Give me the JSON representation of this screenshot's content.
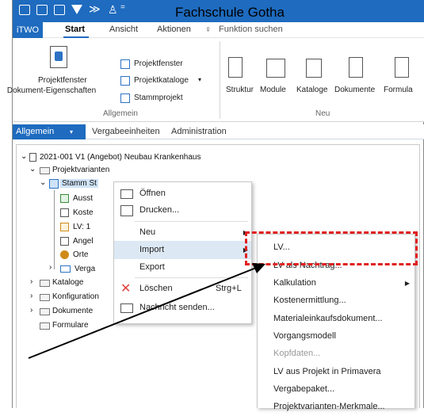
{
  "window": {
    "title": "Fachschule Gotha"
  },
  "ribbon_tabs": [
    "iTWO",
    "Start",
    "Ansicht",
    "Aktionen"
  ],
  "search": {
    "placeholder": "Funktion suchen"
  },
  "ribbon": {
    "big_button_label_1": "Projektfenster",
    "big_button_label_2": "Dokument-Eigenschaften",
    "small_buttons": [
      "Projektfenster",
      "Projektkataloge",
      "Stammprojekt"
    ],
    "group_allgemein": "Allgemein",
    "neu_buttons": [
      "Struktur",
      "Module",
      "Kataloge",
      "Dokumente",
      "Formula"
    ],
    "group_neu": "Neu"
  },
  "nav2": [
    "Allgemein",
    "Vergabeeinheiten",
    "Administration"
  ],
  "tree": {
    "root": "2021-001 V1 (Angebot) Neubau Krankenhaus",
    "projektvarianten": "Projektvarianten",
    "stamm": "Stamm St",
    "children": [
      "Ausst",
      "Koste",
      "LV: 1",
      "Angel",
      "Orte",
      "Verga"
    ],
    "others": [
      "Kataloge",
      "Konfiguration",
      "Dokumente",
      "Formulare"
    ]
  },
  "context_menu": {
    "items": [
      "Öffnen",
      "Drucken...",
      "Neu",
      "Import",
      "Export",
      "Löschen",
      "Nachricht senden..."
    ],
    "shortcut_loeschen": "Strg+L"
  },
  "submenu": {
    "items": [
      "LV...",
      "LV als Nachtrag...",
      "Kalkulation",
      "Kostenermittlung...",
      "Materialeinkaufsdokument...",
      "Vorgangsmodell",
      "Kopfdaten...",
      "LV aus Projekt in Primavera",
      "Vergabepaket...",
      "Projektvarianten-Merkmale..."
    ]
  },
  "colors": {
    "accent": "#1e6bbf",
    "annotation": "#e02020"
  }
}
